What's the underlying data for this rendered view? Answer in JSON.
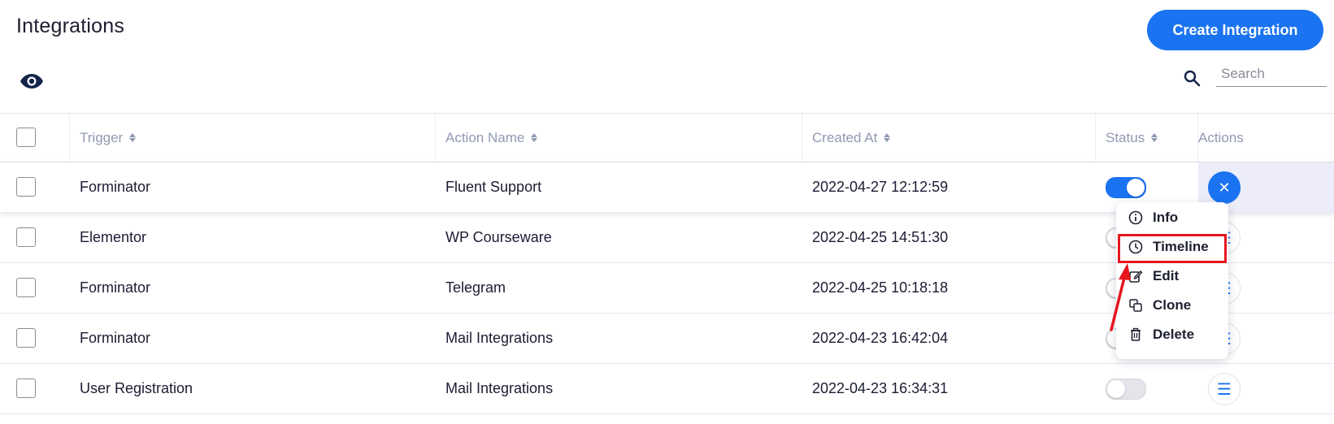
{
  "header": {
    "title": "Integrations",
    "create_button": "Create Integration",
    "search_placeholder": "Search",
    "view_icon": "eye-icon",
    "search_icon": "search-icon"
  },
  "colors": {
    "accent": "#1a73f0",
    "annotation": "#e5161e",
    "header_text": "#8f9ab2"
  },
  "table": {
    "columns": [
      "Trigger",
      "Action Name",
      "Created At",
      "Status",
      "Actions"
    ],
    "rows": [
      {
        "trigger": "Forminator",
        "action": "Fluent Support",
        "created": "2022-04-27 12:12:59",
        "status": true,
        "menu_open": true
      },
      {
        "trigger": "Elementor",
        "action": "WP Courseware",
        "created": "2022-04-25 14:51:30",
        "status": false,
        "menu_open": false
      },
      {
        "trigger": "Forminator",
        "action": "Telegram",
        "created": "2022-04-25 10:18:18",
        "status": false,
        "menu_open": false
      },
      {
        "trigger": "Forminator",
        "action": "Mail Integrations",
        "created": "2022-04-23 16:42:04",
        "status": false,
        "menu_open": false
      },
      {
        "trigger": "User Registration",
        "action": "Mail Integrations",
        "created": "2022-04-23 16:34:31",
        "status": false,
        "menu_open": false
      }
    ]
  },
  "action_menu": {
    "items": [
      {
        "label": "Info",
        "icon": "info-icon"
      },
      {
        "label": "Timeline",
        "icon": "clock-icon",
        "highlighted": true
      },
      {
        "label": "Edit",
        "icon": "edit-icon"
      },
      {
        "label": "Clone",
        "icon": "clone-icon"
      },
      {
        "label": "Delete",
        "icon": "trash-icon"
      }
    ]
  }
}
